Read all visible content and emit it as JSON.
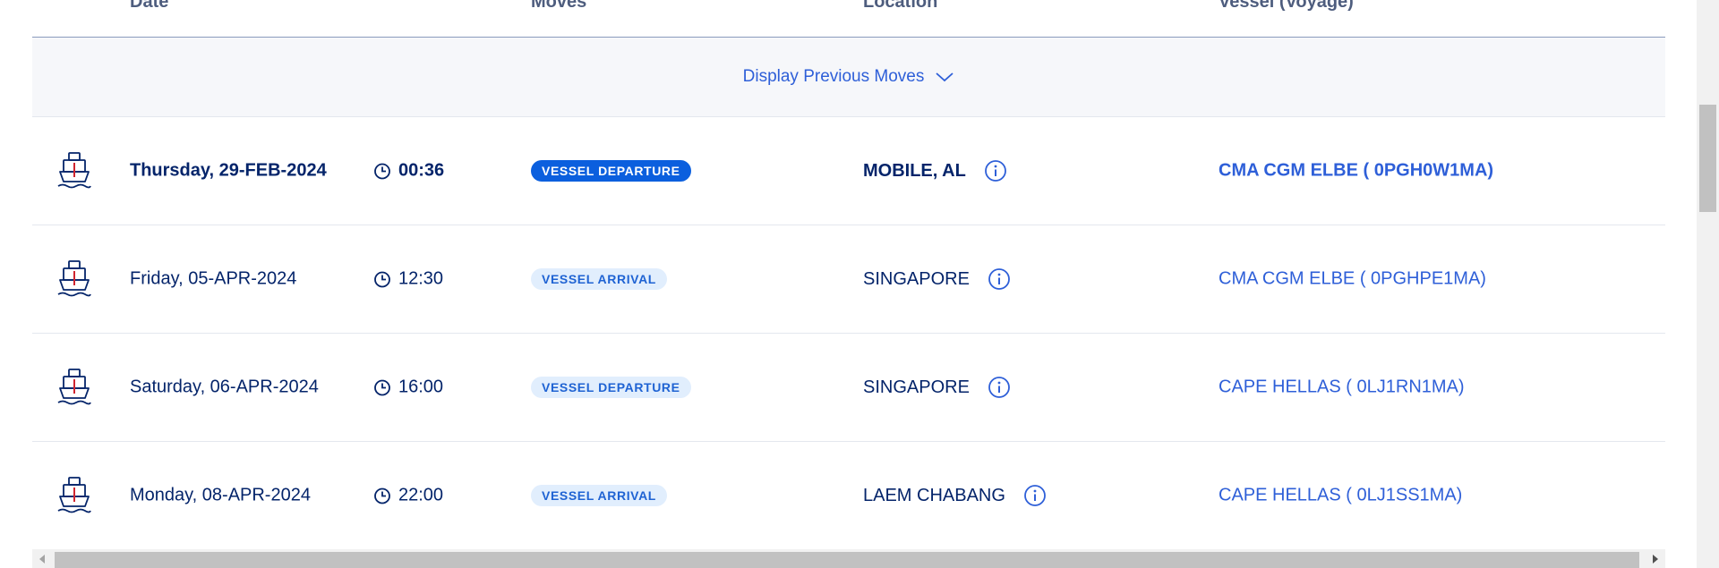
{
  "columns": {
    "date": "Date",
    "moves": "Moves",
    "location": "Location",
    "vessel": "Vessel (Voyage)"
  },
  "previous_moves_label": "Display Previous Moves",
  "rows": [
    {
      "date": "Thursday, 29-FEB-2024",
      "time": "00:36",
      "move": "VESSEL DEPARTURE",
      "location": "MOBILE, AL",
      "vessel": "CMA CGM ELBE ( 0PGH0W1MA)",
      "current": true
    },
    {
      "date": "Friday, 05-APR-2024",
      "time": "12:30",
      "move": "VESSEL ARRIVAL",
      "location": "SINGAPORE",
      "vessel": "CMA CGM ELBE ( 0PGHPE1MA)",
      "current": false
    },
    {
      "date": "Saturday, 06-APR-2024",
      "time": "16:00",
      "move": "VESSEL DEPARTURE",
      "location": "SINGAPORE",
      "vessel": "CAPE HELLAS ( 0LJ1RN1MA)",
      "current": false
    },
    {
      "date": "Monday, 08-APR-2024",
      "time": "22:00",
      "move": "VESSEL ARRIVAL",
      "location": "LAEM CHABANG",
      "vessel": "CAPE HELLAS ( 0LJ1SS1MA)",
      "current": false
    }
  ],
  "icons": {
    "ship": "ship-icon",
    "clock": "clock-icon",
    "info": "info-icon",
    "chevron": "chevron-down-icon"
  },
  "colors": {
    "navy": "#04246a",
    "link": "#2e5fd8",
    "badge_dark": "#0b5fde",
    "badge_light": "#e1eefd",
    "ship_accent": "#d0252f"
  }
}
